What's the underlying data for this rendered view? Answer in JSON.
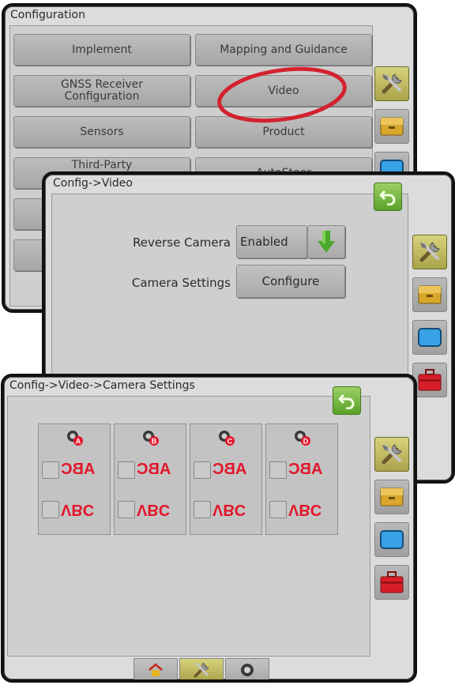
{
  "panel1": {
    "title": "Configuration",
    "buttons": [
      "Implement",
      "Mapping and Guidance",
      "GNSS Receiver\nConfiguration",
      "Video",
      "Sensors",
      "Product",
      "Third-Party",
      "AutoSteer"
    ]
  },
  "panel2": {
    "title": "Config->Video",
    "reverse_camera_label": "Reverse Camera",
    "reverse_camera_value": "Enabled",
    "camera_settings_label": "Camera Settings",
    "camera_settings_button": "Configure"
  },
  "panel3": {
    "title": "Config->Video->Camera Settings",
    "cameras": [
      {
        "id": "A",
        "abc": "ABC",
        "vbc": "VBC"
      },
      {
        "id": "B",
        "abc": "ABC",
        "vbc": "VBC"
      },
      {
        "id": "C",
        "abc": "ABC",
        "vbc": "VBC"
      },
      {
        "id": "D",
        "abc": "ABC",
        "vbc": "VBC"
      }
    ]
  },
  "bottom_tabs": [
    "home-icon",
    "tools-icon",
    "camera-icon"
  ],
  "colors": {
    "highlight_ellipse": "#d3222e",
    "accent_green": "#5ba12a",
    "mirror_text_red": "#e2162b"
  }
}
